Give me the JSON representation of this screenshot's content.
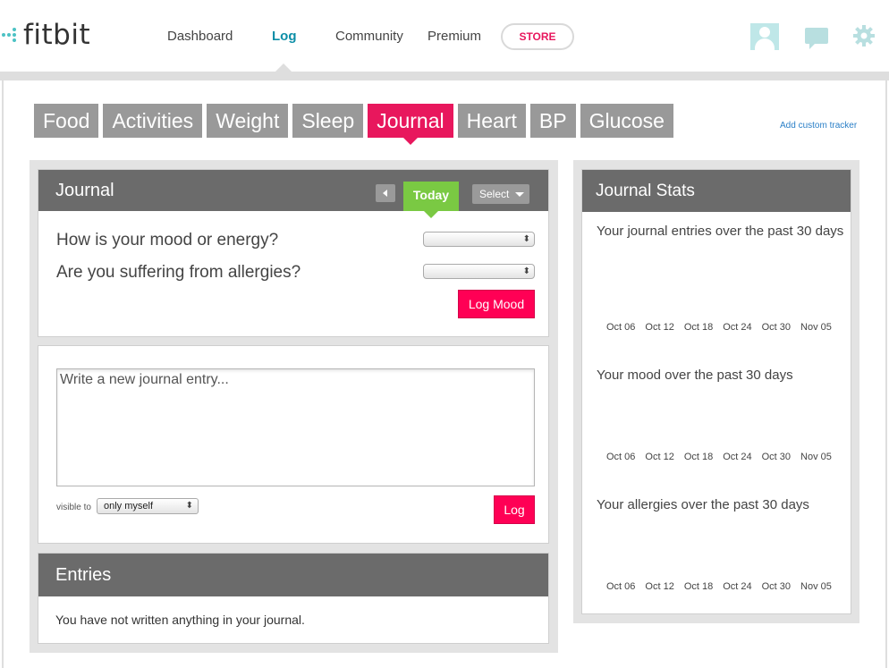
{
  "brand": {
    "name": "fitbit"
  },
  "nav": {
    "dashboard": "Dashboard",
    "log": "Log",
    "community": "Community",
    "premium": "Premium",
    "store": "STORE"
  },
  "icons": {
    "avatar": "avatar-icon",
    "messages": "chat-icon",
    "settings": "gear-icon"
  },
  "tabs": [
    {
      "label": "Food"
    },
    {
      "label": "Activities"
    },
    {
      "label": "Weight"
    },
    {
      "label": "Sleep"
    },
    {
      "label": "Journal",
      "active": true
    },
    {
      "label": "Heart"
    },
    {
      "label": "BP"
    },
    {
      "label": "Glucose"
    }
  ],
  "add_custom_tracker": "Add custom tracker",
  "journal": {
    "title": "Journal",
    "today_label": "Today",
    "select_label": "Select",
    "mood_question": "How is your mood or energy?",
    "allergy_question": "Are you suffering from allergies?",
    "mood_value": "",
    "allergy_value": "",
    "log_mood_label": "Log Mood"
  },
  "new_entry": {
    "placeholder": "Write a new journal entry...",
    "visible_to_label": "visible to",
    "visibility_value": "only myself",
    "log_label": "Log"
  },
  "entries": {
    "title": "Entries",
    "empty_message": "You have not written anything in your journal."
  },
  "stats": {
    "title": "Journal Stats",
    "charts": [
      {
        "title": "Your journal entries over the past 30 days",
        "x_ticks": [
          "Oct 06",
          "Oct 12",
          "Oct 18",
          "Oct 24",
          "Oct 30",
          "Nov 05"
        ]
      },
      {
        "title": "Your mood over the past 30 days",
        "x_ticks": [
          "Oct 06",
          "Oct 12",
          "Oct 18",
          "Oct 24",
          "Oct 30",
          "Nov 05"
        ]
      },
      {
        "title": "Your allergies over the past 30 days",
        "x_ticks": [
          "Oct 06",
          "Oct 12",
          "Oct 18",
          "Oct 24",
          "Oct 30",
          "Nov 05"
        ]
      }
    ]
  },
  "colors": {
    "brand_teal": "#4cc2c4",
    "accent_pink": "#e8175d",
    "button_pink": "#ff0055",
    "today_green": "#7ac943",
    "tab_grey": "#999999",
    "header_grey": "#6b6b6b",
    "link_blue": "#2a7fc7"
  }
}
